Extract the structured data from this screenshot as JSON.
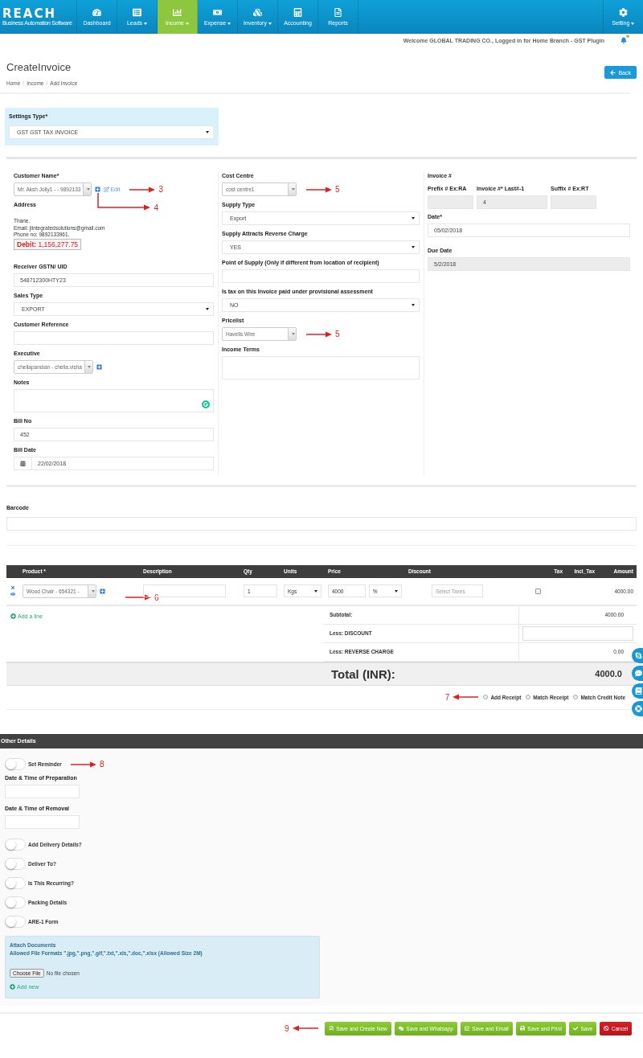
{
  "navbar": {
    "logo": "REACH",
    "tagline": "Business Automation Software",
    "items": [
      {
        "label": "Dashboard",
        "dropdown": false,
        "selected": false
      },
      {
        "label": "Leads",
        "dropdown": true,
        "selected": false
      },
      {
        "label": "Income",
        "dropdown": true,
        "selected": true
      },
      {
        "label": "Expense",
        "dropdown": true,
        "selected": false
      },
      {
        "label": "Inventory",
        "dropdown": true,
        "selected": false
      },
      {
        "label": "Accounting",
        "dropdown": false,
        "selected": false
      },
      {
        "label": "Reports",
        "dropdown": false,
        "selected": false
      }
    ],
    "setting": {
      "label": "Setting",
      "dropdown": true
    }
  },
  "welcome": "Welcome GLOBAL TRADING CO., Logged in for Home Branch - GST Plugin",
  "page": {
    "title": "CreateInvoice",
    "breadcrumbs": [
      "Home",
      "Income",
      "Add Invoice"
    ],
    "breadcrumb_separator": "/",
    "back_button": "Back"
  },
  "settings_type": {
    "label": "Settings Type*",
    "value": "GST GST TAX INVOICE"
  },
  "form": {
    "left": [
      {
        "kind": "combo",
        "label": "Customer Name*",
        "value": "Mr. Aksh Jolly1 - - 9892133",
        "add_button": true,
        "edit_link": "Edit",
        "callout": {
          "number": "3"
        },
        "add_callout": {
          "number": "4"
        }
      },
      {
        "kind": "address",
        "label": "Address",
        "lines": [
          "Thane.",
          "Email: jiintegratedsolutions@gmail.com",
          "Phone no: 9892133961."
        ],
        "debit": "**Debit:** 1,156,277.75"
      },
      {
        "kind": "input",
        "label": "Receiver GSTN/ UID",
        "value": "548712300HTY23"
      },
      {
        "kind": "select",
        "label": "Sales Type",
        "value": "EXPORT"
      },
      {
        "kind": "input",
        "label": "Customer Reference"
      },
      {
        "kind": "combo",
        "label": "Executive",
        "value": "chellapandian - chella.visha",
        "add_button": true
      },
      {
        "kind": "textarea",
        "label": "Notes",
        "spellcheck_badge": true
      },
      {
        "kind": "input",
        "label": "Bill No",
        "value": "452"
      },
      {
        "kind": "date",
        "label": "Bill Date",
        "value": "22/02/2018"
      }
    ],
    "middle": [
      {
        "kind": "combo",
        "label": "Cost Centre",
        "value": "cost centre1",
        "callout": {
          "number": "5"
        }
      },
      {
        "kind": "select",
        "label": "Supply Type",
        "value": "Export"
      },
      {
        "kind": "select",
        "label": "Supply Attracts Reverse Charge",
        "value": "YES"
      },
      {
        "kind": "input",
        "label": "Point of Supply (Only if different from location of recipient)"
      },
      {
        "kind": "select",
        "label": "Is tax on this Invoice paid under provisional assessment",
        "value": "NO"
      },
      {
        "kind": "combo",
        "label": "Pricelist",
        "value": "Havells Wire",
        "callout": {
          "number": "5"
        }
      },
      {
        "kind": "textarea",
        "label": "Income Terms"
      }
    ],
    "right": {
      "invoice_label": "Invoice #",
      "parts": [
        {
          "label": "Prefix # Ex:RA",
          "disabled": true
        },
        {
          "label": "Invoice #* Last#-1",
          "value": "4",
          "disabled": true
        },
        {
          "label": "Suffix # Ex:RT",
          "disabled": true
        }
      ],
      "dates": [
        {
          "label": "Date*",
          "value": "05/02/2018",
          "disabled": false
        },
        {
          "label": "Due Date",
          "value": "5/2/2018",
          "disabled": true
        }
      ]
    }
  },
  "barcode": {
    "label": "Barcode"
  },
  "lines": {
    "columns": [
      "Product *",
      "Description",
      "Qty",
      "Units",
      "Price",
      "Discount",
      "Tax",
      "Incl_Tax",
      "Amount"
    ],
    "rows": [
      {
        "product": "Wood Chair - 654321 -",
        "qty": "1",
        "units": "Kgs",
        "price": "4000",
        "discount": "%",
        "tax_placeholder": "Select Taxes",
        "incl_tax": false,
        "amount": "4000.00",
        "callout": {
          "number": "6"
        }
      }
    ],
    "add_line": "Add a line",
    "totals": [
      {
        "kind": "value",
        "label": "Subtotal:",
        "value": "4000.00"
      },
      {
        "kind": "input",
        "label": "Less: DISCOUNT"
      },
      {
        "kind": "value",
        "label": "Less: REVERSE CHARGE",
        "value": "0.00"
      }
    ],
    "total": {
      "label": "Total (INR):",
      "value": "4000.0"
    },
    "callout": {
      "number": "7"
    },
    "options": [
      {
        "label": "Add Receipt",
        "selected": false
      },
      {
        "label": "Match Receipt",
        "selected": false
      },
      {
        "label": "Match Credit Note",
        "selected": false
      }
    ]
  },
  "other_details": {
    "title": "Other Details",
    "items": [
      {
        "kind": "toggle",
        "label": "Set Reminder",
        "on": false,
        "callout": {
          "number": "8"
        }
      },
      {
        "kind": "input",
        "label": "Date & Time of Preparation"
      },
      {
        "kind": "input",
        "label": "Date & Time of Removal"
      },
      {
        "kind": "toggle",
        "label": "Add Delivery Details?",
        "on": false
      },
      {
        "kind": "toggle",
        "label": "Deliver To?",
        "on": false
      },
      {
        "kind": "toggle",
        "label": "Is This Recurring?",
        "on": false
      },
      {
        "kind": "toggle",
        "label": "Packing Details",
        "on": false
      },
      {
        "kind": "toggle",
        "label": "ARE-1 Form",
        "on": false
      }
    ],
    "attach": {
      "title": "Attach Documents",
      "formats": "Allowed File Formats \".jpg,\".png,\".gif,\".txt,\".xls,\".doc,\".xlsx (Allowed Size 2M)",
      "choose_button": "Choose File",
      "file_status": "No file chosen",
      "add_new": "Add new"
    }
  },
  "footer": {
    "callout": {
      "number": "9"
    },
    "buttons": [
      {
        "label": "Save and Create New",
        "kind": "success"
      },
      {
        "label": "Save and Whatsapp",
        "kind": "success"
      },
      {
        "label": "Save and Email",
        "kind": "success"
      },
      {
        "label": "Save and Print",
        "kind": "success"
      },
      {
        "label": "Save",
        "kind": "success"
      },
      {
        "label": "Cancel",
        "kind": "danger"
      }
    ]
  }
}
